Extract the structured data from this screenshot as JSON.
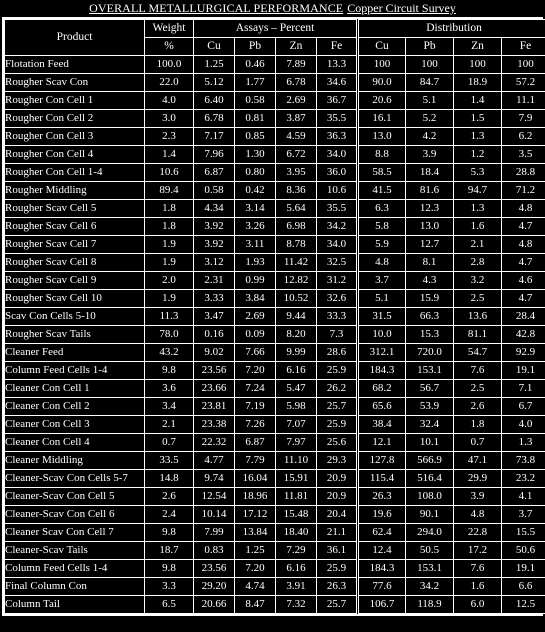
{
  "title": {
    "main": "OVERALL METALLURGICAL PERFORMANCE",
    "sub": "Copper Circuit Survey"
  },
  "table": {
    "header": {
      "product": "Product",
      "weight": "Weight",
      "weight_unit": "%",
      "assays_group": "Assays – Percent",
      "distribution_group": "Distribution",
      "assay_cols": [
        "Cu",
        "Pb",
        "Zn",
        "Fe"
      ],
      "dist_cols": [
        "Cu",
        "Pb",
        "Zn",
        "Fe"
      ]
    },
    "rows": [
      {
        "product": "Flotation Feed",
        "weight": "100.0",
        "assay": [
          "1.25",
          "0.46",
          "7.89",
          "13.3"
        ],
        "dist": [
          "100",
          "100",
          "100",
          "100"
        ]
      },
      {
        "product": "Rougher Scav Con",
        "weight": "22.0",
        "assay": [
          "5.12",
          "1.77",
          "6.78",
          "34.6"
        ],
        "dist": [
          "90.0",
          "84.7",
          "18.9",
          "57.2"
        ]
      },
      {
        "product": "Rougher Con Cell 1",
        "weight": "4.0",
        "assay": [
          "6.40",
          "0.58",
          "2.69",
          "36.7"
        ],
        "dist": [
          "20.6",
          "5.1",
          "1.4",
          "11.1"
        ]
      },
      {
        "product": "Rougher Con Cell 2",
        "weight": "3.0",
        "assay": [
          "6.78",
          "0.81",
          "3.87",
          "35.5"
        ],
        "dist": [
          "16.1",
          "5.2",
          "1.5",
          "7.9"
        ]
      },
      {
        "product": "Rougher Con Cell 3",
        "weight": "2.3",
        "assay": [
          "7.17",
          "0.85",
          "4.59",
          "36.3"
        ],
        "dist": [
          "13.0",
          "4.2",
          "1.3",
          "6.2"
        ]
      },
      {
        "product": "Rougher Con Cell 4",
        "weight": "1.4",
        "assay": [
          "7.96",
          "1.30",
          "6.72",
          "34.0"
        ],
        "dist": [
          "8.8",
          "3.9",
          "1.2",
          "3.5"
        ]
      },
      {
        "product": "Rougher Con Cell 1-4",
        "weight": "10.6",
        "assay": [
          "6.87",
          "0.80",
          "3.95",
          "36.0"
        ],
        "dist": [
          "58.5",
          "18.4",
          "5.3",
          "28.8"
        ]
      },
      {
        "product": "Rougher Middling",
        "weight": "89.4",
        "assay": [
          "0.58",
          "0.42",
          "8.36",
          "10.6"
        ],
        "dist": [
          "41.5",
          "81.6",
          "94.7",
          "71.2"
        ]
      },
      {
        "product": "Rougher Scav Cell 5",
        "weight": "1.8",
        "assay": [
          "4.34",
          "3.14",
          "5.64",
          "35.5"
        ],
        "dist": [
          "6.3",
          "12.3",
          "1.3",
          "4.8"
        ]
      },
      {
        "product": "Rougher Scav Cell 6",
        "weight": "1.8",
        "assay": [
          "3.92",
          "3.26",
          "6.98",
          "34.2"
        ],
        "dist": [
          "5.8",
          "13.0",
          "1.6",
          "4.7"
        ]
      },
      {
        "product": "Rougher Scav Cell 7",
        "weight": "1.9",
        "assay": [
          "3.92",
          "3.11",
          "8.78",
          "34.0"
        ],
        "dist": [
          "5.9",
          "12.7",
          "2.1",
          "4.8"
        ]
      },
      {
        "product": "Rougher Scav Cell 8",
        "weight": "1.9",
        "assay": [
          "3.12",
          "1.93",
          "11.42",
          "32.5"
        ],
        "dist": [
          "4.8",
          "8.1",
          "2.8",
          "4.7"
        ]
      },
      {
        "product": "Rougher Scav Cell 9",
        "weight": "2.0",
        "assay": [
          "2.31",
          "0.99",
          "12.82",
          "31.2"
        ],
        "dist": [
          "3.7",
          "4.3",
          "3.2",
          "4.6"
        ]
      },
      {
        "product": "Rougher Scav Cell 10",
        "weight": "1.9",
        "assay": [
          "3.33",
          "3.84",
          "10.52",
          "32.6"
        ],
        "dist": [
          "5.1",
          "15.9",
          "2.5",
          "4.7"
        ]
      },
      {
        "product": "Scav Con Cells 5-10",
        "weight": "11.3",
        "assay": [
          "3.47",
          "2.69",
          "9.44",
          "33.3"
        ],
        "dist": [
          "31.5",
          "66.3",
          "13.6",
          "28.4"
        ]
      },
      {
        "product": "Rougher Scav Tails",
        "weight": "78.0",
        "assay": [
          "0.16",
          "0.09",
          "8.20",
          "7.3"
        ],
        "dist": [
          "10.0",
          "15.3",
          "81.1",
          "42.8"
        ]
      },
      {
        "product": "Cleaner Feed",
        "weight": "43.2",
        "assay": [
          "9.02",
          "7.66",
          "9.99",
          "28.6"
        ],
        "dist": [
          "312.1",
          "720.0",
          "54.7",
          "92.9"
        ]
      },
      {
        "product": "Column Feed Cells 1-4",
        "weight": "9.8",
        "assay": [
          "23.56",
          "7.20",
          "6.16",
          "25.9"
        ],
        "dist": [
          "184.3",
          "153.1",
          "7.6",
          "19.1"
        ]
      },
      {
        "product": "Cleaner Con Cell 1",
        "weight": "3.6",
        "assay": [
          "23.66",
          "7.24",
          "5.47",
          "26.2"
        ],
        "dist": [
          "68.2",
          "56.7",
          "2.5",
          "7.1"
        ]
      },
      {
        "product": "Cleaner Con Cell 2",
        "weight": "3.4",
        "assay": [
          "23.81",
          "7.19",
          "5.98",
          "25.7"
        ],
        "dist": [
          "65.6",
          "53.9",
          "2.6",
          "6.7"
        ]
      },
      {
        "product": "Cleaner Con Cell 3",
        "weight": "2.1",
        "assay": [
          "23.38",
          "7.26",
          "7.07",
          "25.9"
        ],
        "dist": [
          "38.4",
          "32.4",
          "1.8",
          "4.0"
        ]
      },
      {
        "product": "Cleaner Con Cell 4",
        "weight": "0.7",
        "assay": [
          "22.32",
          "6.87",
          "7.97",
          "25.6"
        ],
        "dist": [
          "12.1",
          "10.1",
          "0.7",
          "1.3"
        ]
      },
      {
        "product": "Cleaner Middling",
        "weight": "33.5",
        "assay": [
          "4.77",
          "7.79",
          "11.10",
          "29.3"
        ],
        "dist": [
          "127.8",
          "566.9",
          "47.1",
          "73.8"
        ]
      },
      {
        "product": "Cleaner-Scav Con Cells 5-7",
        "weight": "14.8",
        "assay": [
          "9.74",
          "16.04",
          "15.91",
          "20.9"
        ],
        "dist": [
          "115.4",
          "516.4",
          "29.9",
          "23.2"
        ]
      },
      {
        "product": "Cleaner-Scav Con Cell 5",
        "weight": "2.6",
        "assay": [
          "12.54",
          "18.96",
          "11.81",
          "20.9"
        ],
        "dist": [
          "26.3",
          "108.0",
          "3.9",
          "4.1"
        ]
      },
      {
        "product": "Cleaner-Scav Con Cell 6",
        "weight": "2.4",
        "assay": [
          "10.14",
          "17.12",
          "15.48",
          "20.4"
        ],
        "dist": [
          "19.6",
          "90.1",
          "4.8",
          "3.7"
        ]
      },
      {
        "product": "Cleaner Scav Con Cell 7",
        "weight": "9.8",
        "assay": [
          "7.99",
          "13.84",
          "18.40",
          "21.1"
        ],
        "dist": [
          "62.4",
          "294.0",
          "22.8",
          "15.5"
        ]
      },
      {
        "product": "Cleaner-Scav Tails",
        "weight": "18.7",
        "assay": [
          "0.83",
          "1.25",
          "7.29",
          "36.1"
        ],
        "dist": [
          "12.4",
          "50.5",
          "17.2",
          "50.6"
        ]
      },
      {
        "product": "Column Feed Cells 1-4",
        "weight": "9.8",
        "assay": [
          "23.56",
          "7.20",
          "6.16",
          "25.9"
        ],
        "dist": [
          "184.3",
          "153.1",
          "7.6",
          "19.1"
        ]
      },
      {
        "product": "Final Column Con",
        "weight": "3.3",
        "assay": [
          "29.20",
          "4.74",
          "3.91",
          "26.3"
        ],
        "dist": [
          "77.6",
          "34.2",
          "1.6",
          "6.6"
        ]
      },
      {
        "product": "Column Tail",
        "weight": "6.5",
        "assay": [
          "20.66",
          "8.47",
          "7.32",
          "25.7"
        ],
        "dist": [
          "106.7",
          "118.9",
          "6.0",
          "12.5"
        ]
      }
    ]
  }
}
